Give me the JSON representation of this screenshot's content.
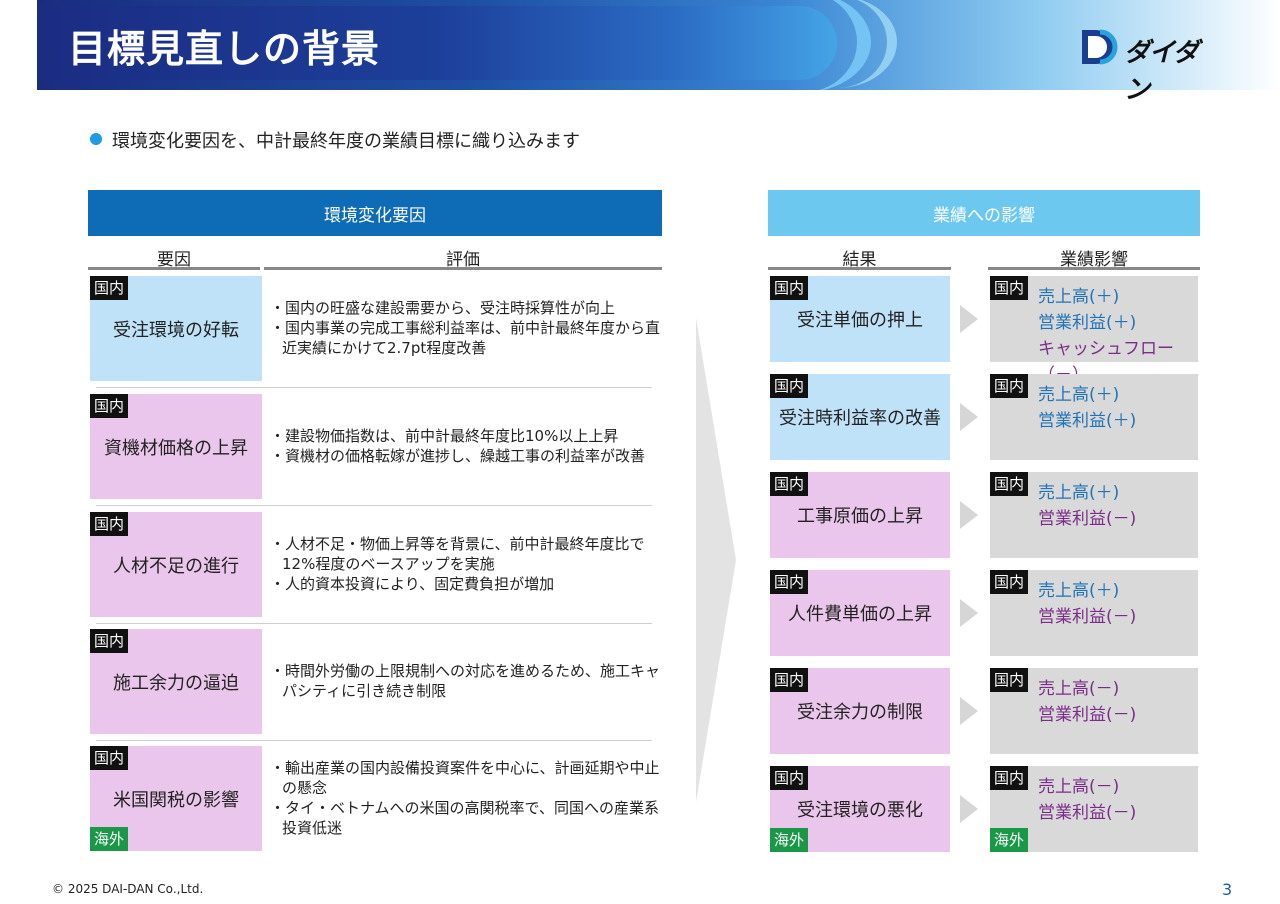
{
  "header": {
    "title": "目標見直しの背景",
    "logo_text": "ダイダン"
  },
  "lead": "環境変化要因を、中計最終年度の業績目標に織り込みます",
  "left": {
    "section_title": "環境変化要因",
    "col_factor": "要因",
    "col_eval": "評価",
    "rows": [
      {
        "tag": "国内",
        "factor": "受注環境の好転",
        "color": "blue",
        "tag2": "",
        "evals": [
          "・国内の旺盛な建設需要から、受注時採算性が向上",
          "・国内事業の完成工事総利益率は、前中計最終年度から直近実績にかけて2.7pt程度改善"
        ]
      },
      {
        "tag": "国内",
        "factor": "資機材価格の上昇",
        "color": "pink",
        "tag2": "",
        "evals": [
          "・建設物価指数は、前中計最終年度比10%以上上昇",
          "・資機材の価格転嫁が進捗し、繰越工事の利益率が改善"
        ]
      },
      {
        "tag": "国内",
        "factor": "人材不足の進行",
        "color": "pink",
        "tag2": "",
        "evals": [
          "・人材不足・物価上昇等を背景に、前中計最終年度比で12%程度のベースアップを実施",
          "・人的資本投資により、固定費負担が増加"
        ]
      },
      {
        "tag": "国内",
        "factor": "施工余力の逼迫",
        "color": "pink",
        "tag2": "",
        "evals": [
          "・時間外労働の上限規制への対応を進めるため、施工キャパシティに引き続き制限"
        ]
      },
      {
        "tag": "国内",
        "factor": "米国関税の影響",
        "color": "pink",
        "tag2": "海外",
        "evals": [
          "・輸出産業の国内設備投資案件を中心に、計画延期や中止の懸念",
          "・タイ・ベトナムへの米国の高関税率で、同国への産業系投資低迷"
        ]
      }
    ]
  },
  "right": {
    "section_title": "業績への影響",
    "col_result": "結果",
    "col_impact": "業績影響",
    "rows": [
      {
        "tag": "国内",
        "tag2": "",
        "result": "受注単価の押上",
        "color": "blue",
        "itag": "国内",
        "itag2": "",
        "impacts": [
          {
            "text": "売上高(＋)",
            "sign": "plus"
          },
          {
            "text": "営業利益(＋)",
            "sign": "plus"
          },
          {
            "text": "キャッシュフロー（－）",
            "sign": "minus"
          }
        ]
      },
      {
        "tag": "国内",
        "tag2": "",
        "result": "受注時利益率の改善",
        "color": "blue",
        "itag": "国内",
        "itag2": "",
        "impacts": [
          {
            "text": "売上高(＋)",
            "sign": "plus"
          },
          {
            "text": "営業利益(＋)",
            "sign": "plus"
          }
        ]
      },
      {
        "tag": "国内",
        "tag2": "",
        "result": "工事原価の上昇",
        "color": "pink",
        "itag": "国内",
        "itag2": "",
        "impacts": [
          {
            "text": "売上高(＋)",
            "sign": "plus"
          },
          {
            "text": "営業利益(－)",
            "sign": "minus"
          }
        ]
      },
      {
        "tag": "国内",
        "tag2": "",
        "result": "人件費単価の上昇",
        "color": "pink",
        "itag": "国内",
        "itag2": "",
        "impacts": [
          {
            "text": "売上高(＋)",
            "sign": "plus"
          },
          {
            "text": "営業利益(－)",
            "sign": "minus"
          }
        ]
      },
      {
        "tag": "国内",
        "tag2": "",
        "result": "受注余力の制限",
        "color": "pink",
        "itag": "国内",
        "itag2": "",
        "impacts": [
          {
            "text": "売上高(－)",
            "sign": "minus"
          },
          {
            "text": "営業利益(－)",
            "sign": "minus"
          }
        ]
      },
      {
        "tag": "国内",
        "tag2": "海外",
        "result": "受注環境の悪化",
        "color": "pink",
        "itag": "国内",
        "itag2": "海外",
        "impacts": [
          {
            "text": "売上高(－)",
            "sign": "minus"
          },
          {
            "text": "営業利益(－)",
            "sign": "minus"
          }
        ]
      }
    ]
  },
  "footer": {
    "copyright": "© 2025 DAI-DAN Co.,Ltd.",
    "page": "3"
  }
}
